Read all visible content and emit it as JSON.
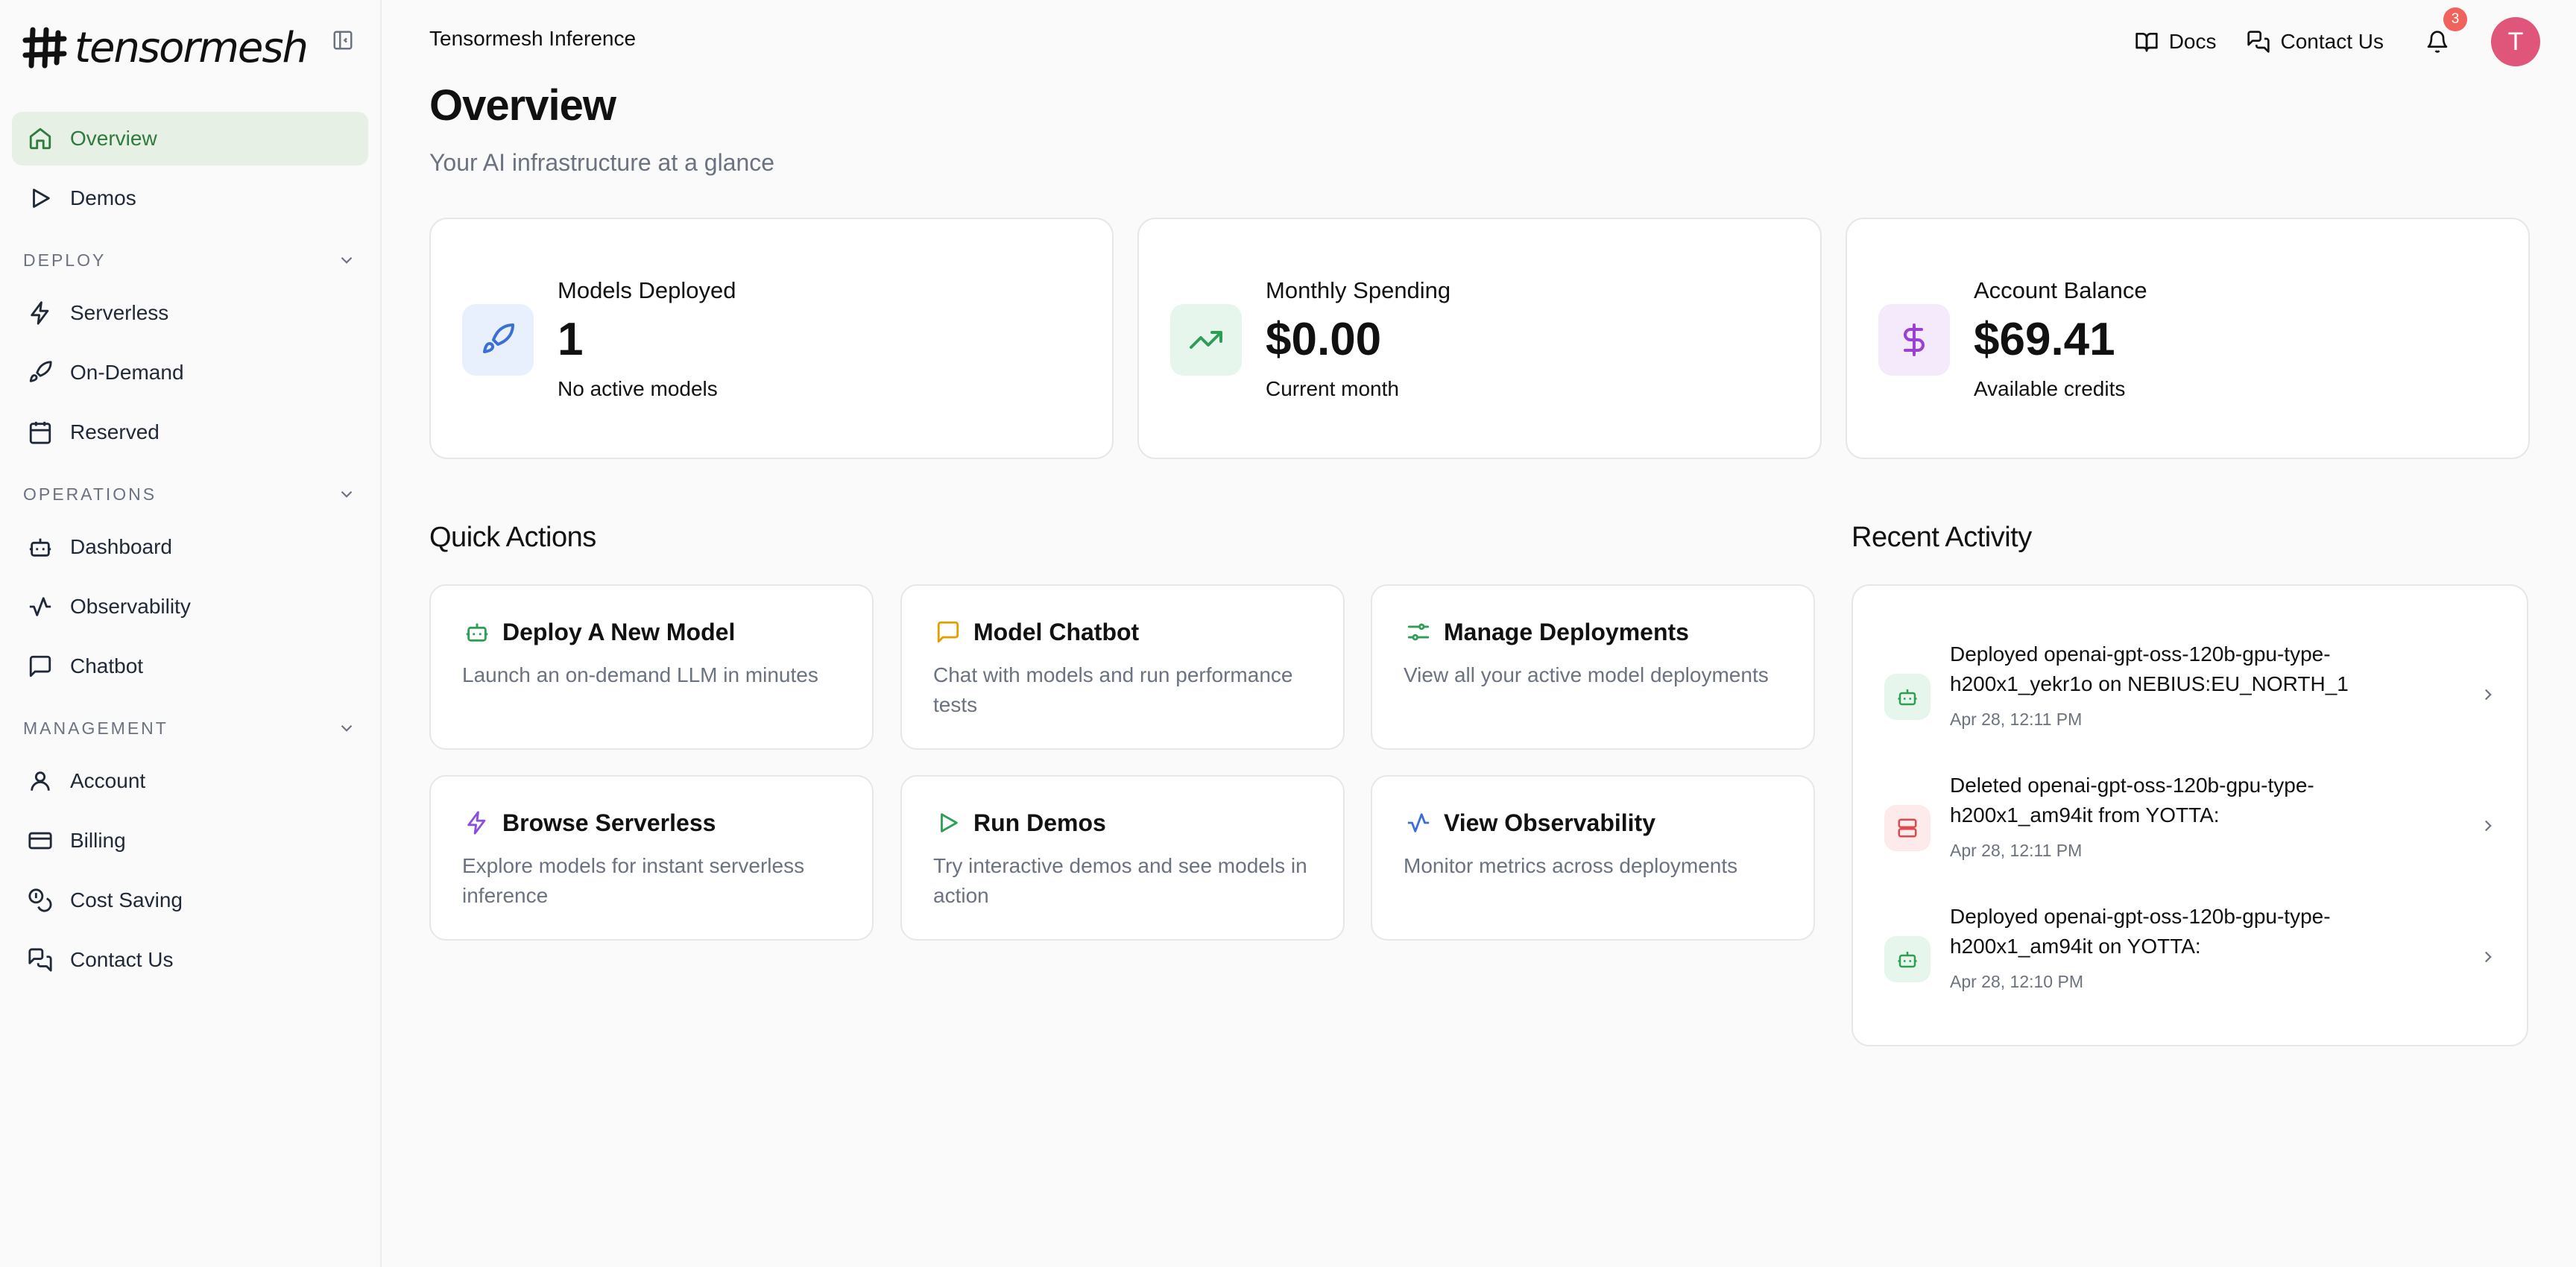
{
  "brand": {
    "name": "tensormesh"
  },
  "sidebar": {
    "top_items": [
      {
        "label": "Overview",
        "icon": "home-icon",
        "active": true
      },
      {
        "label": "Demos",
        "icon": "play-icon",
        "active": false
      }
    ],
    "sections": [
      {
        "title": "DEPLOY",
        "items": [
          {
            "label": "Serverless",
            "icon": "lightning-icon"
          },
          {
            "label": "On-Demand",
            "icon": "rocket-icon"
          },
          {
            "label": "Reserved",
            "icon": "calendar-icon"
          }
        ]
      },
      {
        "title": "OPERATIONS",
        "items": [
          {
            "label": "Dashboard",
            "icon": "robot-icon"
          },
          {
            "label": "Observability",
            "icon": "activity-icon"
          },
          {
            "label": "Chatbot",
            "icon": "chat-icon"
          }
        ]
      },
      {
        "title": "MANAGEMENT",
        "items": [
          {
            "label": "Account",
            "icon": "user-icon"
          },
          {
            "label": "Billing",
            "icon": "credit-card-icon"
          },
          {
            "label": "Cost Saving",
            "icon": "coins-icon"
          },
          {
            "label": "Contact Us",
            "icon": "messages-icon"
          }
        ]
      }
    ]
  },
  "header": {
    "title": "Tensormesh Inference",
    "docs_label": "Docs",
    "contact_label": "Contact Us",
    "notification_count": "3",
    "avatar_initial": "T"
  },
  "page": {
    "title": "Overview",
    "subtitle": "Your AI infrastructure at a glance"
  },
  "stats": [
    {
      "label": "Models Deployed",
      "value": "1",
      "note": "No active models",
      "icon": "rocket-icon",
      "color": "#3b6fd6",
      "bg": "#e8f0fd"
    },
    {
      "label": "Monthly Spending",
      "value": "$0.00",
      "note": "Current month",
      "icon": "trending-up-icon",
      "color": "#2f9e55",
      "bg": "#e7f6ec"
    },
    {
      "label": "Account Balance",
      "value": "$69.41",
      "note": "Available credits",
      "icon": "dollar-icon",
      "color": "#9b3fd6",
      "bg": "#f5e9fc"
    }
  ],
  "quick_actions": {
    "title": "Quick Actions",
    "items": [
      {
        "title": "Deploy A New Model",
        "desc": "Launch an on-demand LLM in minutes",
        "icon": "robot-icon",
        "color": "#2f9e55"
      },
      {
        "title": "Model Chatbot",
        "desc": "Chat with models and run performance tests",
        "icon": "chat-icon",
        "color": "#e0a100"
      },
      {
        "title": "Manage Deployments",
        "desc": "View all your active model deployments",
        "icon": "sliders-icon",
        "color": "#2f9e55"
      },
      {
        "title": "Browse Serverless",
        "desc": "Explore models for instant serverless inference",
        "icon": "lightning-icon",
        "color": "#8b4fe0"
      },
      {
        "title": "Run Demos",
        "desc": "Try interactive demos and see models in action",
        "icon": "play-icon",
        "color": "#2f9e55"
      },
      {
        "title": "View Observability",
        "desc": "Monitor metrics across deployments",
        "icon": "activity-icon",
        "color": "#3b6fd6"
      }
    ]
  },
  "activity": {
    "title": "Recent Activity",
    "items": [
      {
        "text": "Deployed openai-gpt-oss-120b-gpu-type-h200x1_yekr1o on NEBIUS:EU_NORTH_1",
        "time": "Apr 28, 12:11 PM",
        "icon": "robot-icon",
        "color": "#2f9e55",
        "bg": "#e7f6ec"
      },
      {
        "text": "Deleted openai-gpt-oss-120b-gpu-type-h200x1_am94it from YOTTA:",
        "time": "Apr 28, 12:11 PM",
        "icon": "server-icon",
        "color": "#e0484d",
        "bg": "#fdeaea"
      },
      {
        "text": "Deployed openai-gpt-oss-120b-gpu-type-h200x1_am94it on YOTTA:",
        "time": "Apr 28, 12:10 PM",
        "icon": "robot-icon",
        "color": "#2f9e55",
        "bg": "#e7f6ec"
      }
    ]
  }
}
